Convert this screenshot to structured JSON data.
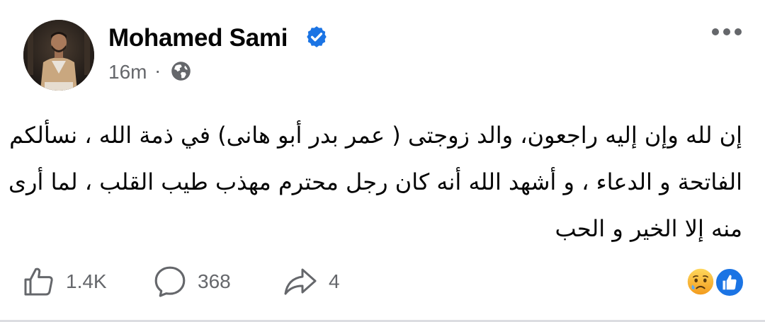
{
  "post": {
    "author_name": "Mohamed Sami",
    "verified_icon": "verified-badge-icon",
    "timestamp": "16m",
    "separator": "·",
    "audience_icon": "globe-icon",
    "more_icon": "more-options-icon",
    "text_lines": [
      "إن لله وإن إليه راجعون،  والد زوجتى ( عمر بدر أبو هانى) في ذمة الله ، نسألكم",
      "الفاتحة و الدعاء ، و أشهد الله أنه كان رجل محترم مهذب طيب القلب ، لما أرى",
      "منه إلا الخير و الحب"
    ]
  },
  "actions": {
    "like": {
      "icon": "thumbs-up-icon",
      "count": "1.4K"
    },
    "comment": {
      "icon": "comment-icon",
      "count": "368"
    },
    "share": {
      "icon": "share-icon",
      "count": "4"
    }
  },
  "reactions": [
    "sad-reaction-icon",
    "like-reaction-icon"
  ],
  "colors": {
    "verified": "#1b74e4",
    "secondary_text": "#65676b",
    "primary_text": "#050505",
    "like_reaction": "#1b74e4",
    "sad_reaction": "#f7b125"
  }
}
